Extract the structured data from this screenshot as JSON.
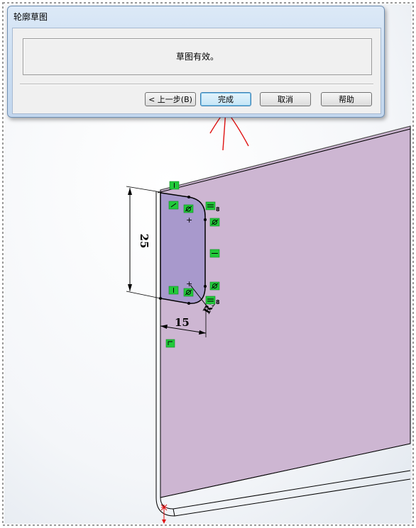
{
  "dialog": {
    "title": "轮廓草图",
    "message": "草图有效。",
    "buttons": {
      "back": "< 上一步(B)",
      "finish": "完成",
      "cancel": "取消",
      "help": "帮助"
    }
  },
  "sketch": {
    "dim_height": "25",
    "dim_width": "15",
    "dim_radius": "R5"
  },
  "colors": {
    "face": "#cdb6d2",
    "profile": "#a899cc",
    "relation": "#22c93a",
    "annotation": "#e01010"
  }
}
